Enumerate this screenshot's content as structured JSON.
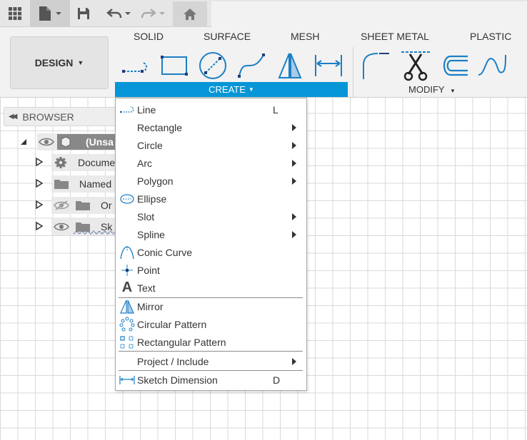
{
  "toolbar": {
    "workspace_button": "DESIGN",
    "tabs": [
      "SOLID",
      "SURFACE",
      "MESH",
      "SHEET METAL",
      "PLASTIC"
    ],
    "create_label": "CREATE",
    "modify_label": "MODIFY"
  },
  "icons": {
    "app_grid": "grid-icon",
    "file": "file-icon",
    "save": "save-icon",
    "undo": "undo-icon",
    "redo": "redo-icon",
    "home": "home-icon"
  },
  "browser": {
    "title": "BROWSER",
    "nodes": [
      {
        "label": "(Unsa"
      },
      {
        "label": "Docume"
      },
      {
        "label": "Named"
      },
      {
        "label": "Or"
      },
      {
        "label": "Sk"
      }
    ]
  },
  "create_menu": {
    "items": [
      {
        "label": "Line",
        "shortcut": "L"
      },
      {
        "label": "Rectangle"
      },
      {
        "label": "Circle"
      },
      {
        "label": "Arc"
      },
      {
        "label": "Polygon"
      },
      {
        "label": "Ellipse"
      },
      {
        "label": "Slot"
      },
      {
        "label": "Spline"
      },
      {
        "label": "Conic Curve"
      },
      {
        "label": "Point"
      },
      {
        "label": "Text"
      },
      {
        "label": "Mirror"
      },
      {
        "label": "Circular Pattern"
      },
      {
        "label": "Rectangular Pattern"
      },
      {
        "label": "Project / Include"
      },
      {
        "label": "Sketch Dimension",
        "shortcut": "D"
      }
    ]
  },
  "colors": {
    "accent": "#0696d7",
    "icon_blue": "#1b7fc4"
  }
}
